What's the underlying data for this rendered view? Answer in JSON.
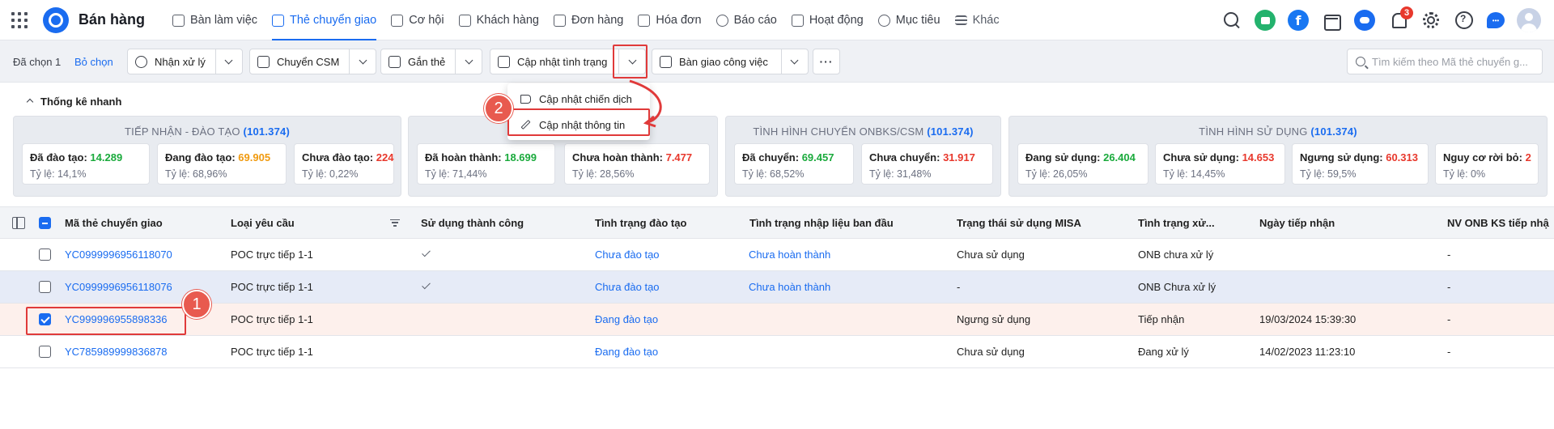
{
  "app": {
    "title": "Bán hàng"
  },
  "nav": {
    "items": [
      {
        "label": "Bàn làm việc"
      },
      {
        "label": "Thẻ chuyển giao"
      },
      {
        "label": "Cơ hội"
      },
      {
        "label": "Khách hàng"
      },
      {
        "label": "Đơn hàng"
      },
      {
        "label": "Hóa đơn"
      },
      {
        "label": "Báo cáo"
      },
      {
        "label": "Hoạt động"
      },
      {
        "label": "Mục tiêu"
      },
      {
        "label": "Khác"
      }
    ],
    "active": "Thẻ chuyển giao",
    "notification_count": "3",
    "facebook_glyph": "f"
  },
  "toolbar": {
    "selected_label": "Đã chọn 1",
    "deselect_label": "Bỏ chọn",
    "buttons": [
      {
        "label": "Nhận xử lý"
      },
      {
        "label": "Chuyển CSM"
      },
      {
        "label": "Gắn thẻ"
      },
      {
        "label": "Cập nhật tình trạng"
      },
      {
        "label": "Bàn giao công việc"
      }
    ],
    "more_label": "···",
    "search_placeholder": "Tìm kiếm theo Mã thẻ chuyển g..."
  },
  "dropdown": {
    "items": [
      {
        "label": "Cập nhật chiến dịch"
      },
      {
        "label": "Cập nhật thông tin"
      }
    ]
  },
  "annotations": {
    "marker1": "1",
    "marker2": "2"
  },
  "stats": {
    "toggle_label": "Thống kê nhanh",
    "groups": [
      {
        "title": "TIẾP NHẬN - ĐÀO TẠO",
        "total": "(101.374)",
        "cards": [
          {
            "label": "Đã đào tạo:",
            "value": "14.289",
            "rate": "Tỷ lệ: 14,1%"
          },
          {
            "label": "Đang đào tạo:",
            "value": "69.905",
            "rate": "Tỷ lệ: 68,96%"
          },
          {
            "label": "Chưa đào tạo:",
            "value": "224",
            "rate": "Tỷ lệ: 0,22%"
          }
        ]
      },
      {
        "title": "",
        "total": "",
        "cards": [
          {
            "label": "Đã hoàn thành:",
            "value": "18.699",
            "rate": "Tỷ lệ: 71,44%"
          },
          {
            "label": "Chưa hoàn thành:",
            "value": "7.477",
            "rate": "Tỷ lệ: 28,56%"
          }
        ]
      },
      {
        "title": "TÌNH HÌNH CHUYỂN ONBKS/CSM",
        "total": "(101.374)",
        "cards": [
          {
            "label": "Đã chuyển:",
            "value": "69.457",
            "rate": "Tỷ lệ: 68,52%"
          },
          {
            "label": "Chưa chuyển:",
            "value": "31.917",
            "rate": "Tỷ lệ: 31,48%"
          }
        ]
      },
      {
        "title": "TÌNH HÌNH SỬ DỤNG",
        "total": "(101.374)",
        "cards": [
          {
            "label": "Đang sử dụng:",
            "value": "26.404",
            "rate": "Tỷ lệ: 26,05%"
          },
          {
            "label": "Chưa sử dụng:",
            "value": "14.653",
            "rate": "Tỷ lệ: 14,45%"
          },
          {
            "label": "Ngưng sử dụng:",
            "value": "60.313",
            "rate": "Tỷ lệ: 59,5%"
          },
          {
            "label": "Nguy cơ rời bỏ:",
            "value": "2",
            "rate": "Tỷ lệ: 0%"
          }
        ]
      }
    ],
    "colors": {
      "green": "#1aaa3c",
      "orange": "#f09a0f",
      "red": "#e8382c",
      "blue": "#1a6cf0"
    }
  },
  "table": {
    "columns": [
      "Mã thẻ chuyển giao",
      "Loại yêu cầu",
      "Sử dụng thành công",
      "Tình trạng đào tạo",
      "Tình trạng nhập liệu ban đầu",
      "Trạng thái sử dụng MISA",
      "Tình trạng xử...",
      "Ngày tiếp nhận",
      "NV ONB KS tiếp nhậ"
    ],
    "rows": [
      {
        "code": "YC0999996956118070",
        "type": "POC trực tiếp 1-1",
        "success": true,
        "training": "Chưa đào tạo",
        "input": "Chưa hoàn thành",
        "misa": "Chưa sử dụng",
        "process": "ONB chưa xử lý",
        "date": "",
        "staff": "-"
      },
      {
        "code": "YC0999996956118076",
        "type": "POC trực tiếp 1-1",
        "success": true,
        "training": "Chưa đào tạo",
        "input": "Chưa hoàn thành",
        "misa": "-",
        "process": "ONB Chưa xử lý",
        "date": "",
        "staff": "-"
      },
      {
        "code": "YC999996955898336",
        "type": "POC trực tiếp 1-1",
        "success": false,
        "training": "Đang đào tạo",
        "input": "",
        "misa": "Ngưng sử dụng",
        "process": "Tiếp nhận",
        "date": "19/03/2024 15:39:30",
        "staff": "-"
      },
      {
        "code": "YC785989999836878",
        "type": "POC trực tiếp 1-1",
        "success": false,
        "training": "Đang đào tạo",
        "input": "",
        "misa": "Chưa sử dụng",
        "process": "Đang xử lý",
        "date": "14/02/2023 11:23:10",
        "staff": "-"
      }
    ]
  }
}
